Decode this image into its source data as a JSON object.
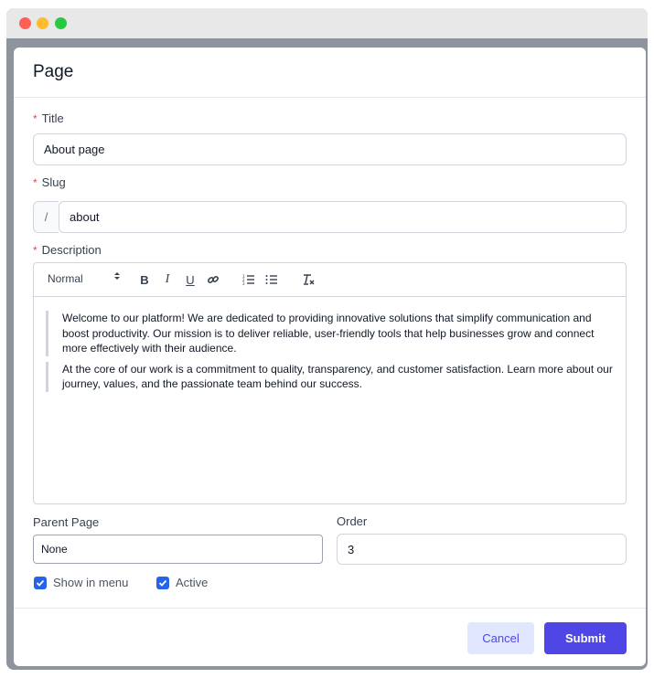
{
  "page": {
    "title": "Page"
  },
  "form": {
    "title": {
      "label": "Title",
      "required_mark": "*",
      "value": "About page"
    },
    "slug": {
      "label": "Slug",
      "required_mark": "*",
      "prefix": "/",
      "value": "about"
    },
    "description": {
      "label": "Description",
      "required_mark": "*",
      "toolbar": {
        "format_select": "Normal",
        "buttons": [
          "bold-icon",
          "italic-icon",
          "underline-icon",
          "link-icon",
          "ordered-list-icon",
          "bullet-list-icon",
          "clear-format-icon"
        ]
      },
      "paragraphs": [
        "Welcome to our platform! We are dedicated to providing innovative solutions that simplify communication and boost productivity. Our mission is to deliver reliable, user-friendly tools that help businesses grow and connect more effectively with their audience.",
        "At the core of our work is a commitment to quality, transparency, and customer satisfaction. Learn more about our journey, values, and the passionate team behind our success."
      ]
    },
    "parent_page": {
      "label": "Parent Page",
      "value": "None"
    },
    "order": {
      "label": "Order",
      "value": "3"
    },
    "show_in_menu": {
      "label": "Show in menu",
      "checked": true
    },
    "active": {
      "label": "Active",
      "checked": true
    }
  },
  "footer": {
    "cancel_label": "Cancel",
    "submit_label": "Submit"
  },
  "colors": {
    "accent": "#4f46e5",
    "checkbox": "#2563eb",
    "required": "#ef4444",
    "cancel_bg": "#e0e7ff"
  }
}
